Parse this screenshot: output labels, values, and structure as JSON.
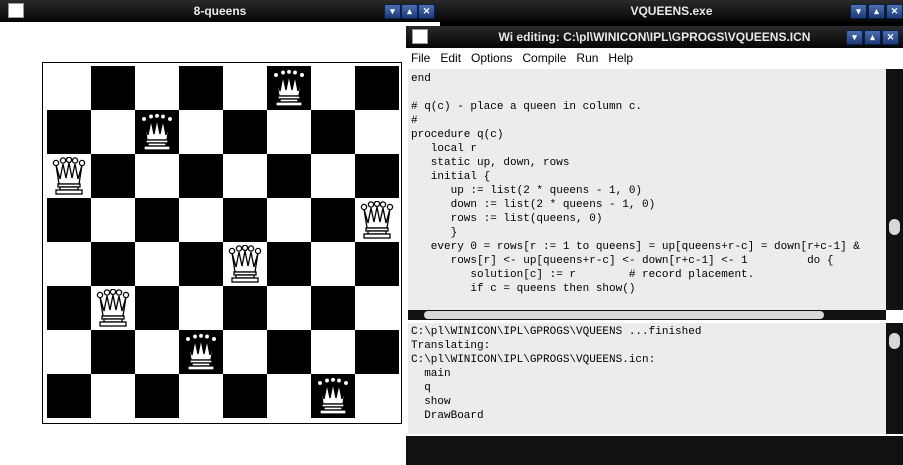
{
  "background_window": {
    "title": "VQUEENS.exe"
  },
  "queens_window": {
    "title": "8-queens",
    "queen_positions": [
      {
        "col": 1,
        "row": 3
      },
      {
        "col": 2,
        "row": 6
      },
      {
        "col": 3,
        "row": 2
      },
      {
        "col": 4,
        "row": 7
      },
      {
        "col": 5,
        "row": 5
      },
      {
        "col": 6,
        "row": 1
      },
      {
        "col": 7,
        "row": 8
      },
      {
        "col": 8,
        "row": 4
      }
    ]
  },
  "editor_window": {
    "title": "Wi editing: C:\\pl\\WINICON\\IPL\\GPROGS\\VQUEENS.ICN",
    "menu": [
      "File",
      "Edit",
      "Options",
      "Compile",
      "Run",
      "Help"
    ],
    "code": "end\n\n# q(c) - place a queen in column c.\n#\nprocedure q(c)\n   local r\n   static up, down, rows\n   initial {\n      up := list(2 * queens - 1, 0)\n      down := list(2 * queens - 1, 0)\n      rows := list(queens, 0)\n      }\n   every 0 = rows[r := 1 to queens] = up[queens+r-c] = down[r+c-1] &\n      rows[r] <- up[queens+r-c] <- down[r+c-1] <- 1         do {\n         solution[c] := r        # record placement.\n         if c = queens then show()",
    "output": "C:\\pl\\WINICON\\IPL\\GPROGS\\VQUEENS ...finished\nTranslating:\nC:\\pl\\WINICON\\IPL\\GPROGS\\VQUEENS.icn:\n  main\n  q\n  show\n  DrawBoard"
  },
  "colors": {
    "light_square": "#ffffff",
    "dark_square": "#000000"
  },
  "icons": {
    "minimize": "minimize-icon",
    "restore": "restore-icon",
    "close": "close-icon"
  }
}
